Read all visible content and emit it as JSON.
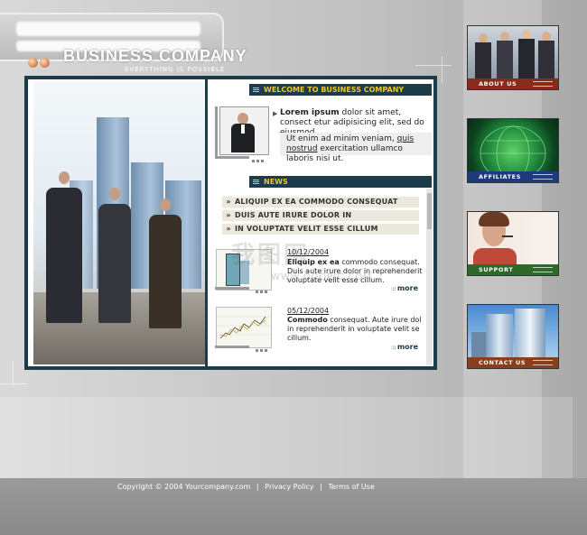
{
  "branding": {
    "company_name": "BUSINESS COMPANY",
    "tagline": "EVERYTHING IS POSSIBLE"
  },
  "welcome": {
    "heading": "WELCOME TO BUSINESS COMPANY",
    "para1_bold": "Lorem ipsum",
    "para1_rest": " dolor sit amet, consect etur adipisicing elit, sed do eiusmod.",
    "para2_start": "Ut enim ad minim veniam, ",
    "para2_link": "quis nostrud",
    "para2_end": " exercitation ullamco laboris nisi ut."
  },
  "news": {
    "heading": "NEWS",
    "headlines": [
      "ALIQUIP EX EA COMMODO CONSEQUAT",
      "DUIS AUTE IRURE DOLOR IN",
      "IN VOLUPTATE VELIT ESSE CILLUM"
    ],
    "items": [
      {
        "date": "10/12/2004",
        "bold": "Eliquip ex ea",
        "text": " commodo consequat. Duis aute irure dolor in reprehenderit voluptate velit esse cillum.",
        "more": "more"
      },
      {
        "date": "05/12/2004",
        "bold": "Commodo",
        "text": " consequat. Aute irure dol in reprehenderit in voluptate velit se cillum.",
        "more": "more"
      }
    ]
  },
  "nav_tiles": [
    {
      "label": "ABOUT US",
      "color": "#8a2a1a"
    },
    {
      "label": "AFFILIATES",
      "color": "#1e3a7a"
    },
    {
      "label": "SUPPORT",
      "color": "#2d6a2a"
    },
    {
      "label": "CONTACT US",
      "color": "#8a3e1e"
    }
  ],
  "footer": {
    "copyright": "Copyright © 2004 Yourcompany.com",
    "privacy": "Privacy Policy",
    "terms": "Terms of Use",
    "separator": "|"
  },
  "watermark": {
    "text": "我图网",
    "url": "WWW.OOOPIC.COM"
  },
  "colors": {
    "frame": "#1c3c4a",
    "header_text": "#f0c629",
    "news_row_bg": "#ece9dc"
  }
}
